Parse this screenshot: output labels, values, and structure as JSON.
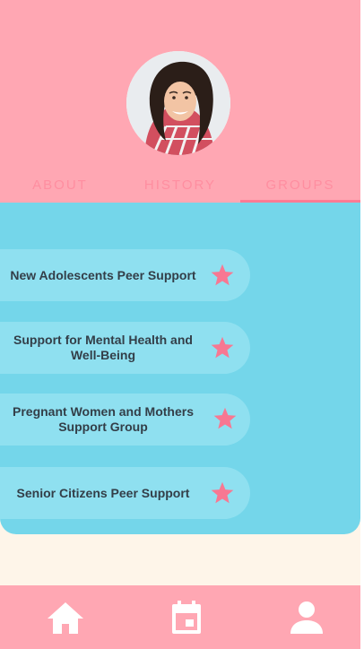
{
  "profile": {
    "avatar_icon": "profile-photo"
  },
  "tabs": [
    {
      "label": "ABOUT",
      "active": false
    },
    {
      "label": "HISTORY",
      "active": false
    },
    {
      "label": "GROUPS",
      "active": true
    }
  ],
  "groups": [
    {
      "label": "New Adolescents Peer Support",
      "icon": "star-icon"
    },
    {
      "label": "Support for Mental Health and Well-Being",
      "icon": "star-icon"
    },
    {
      "label": "Pregnant Women and Mothers Support Group",
      "icon": "star-icon"
    },
    {
      "label": "Senior Citizens Peer Support",
      "icon": "star-icon"
    }
  ],
  "bottom_nav": [
    {
      "icon": "home-icon"
    },
    {
      "icon": "calendar-icon"
    },
    {
      "icon": "person-icon"
    }
  ],
  "colors": {
    "header_bg": "#ffa7b3",
    "tab_text": "#ff8ea0",
    "panel_bg": "#74d6ea",
    "card_bg": "#8fe0f0",
    "star": "#f77892",
    "nav_icon": "#ffffff",
    "page_bg": "#fef5e9"
  }
}
